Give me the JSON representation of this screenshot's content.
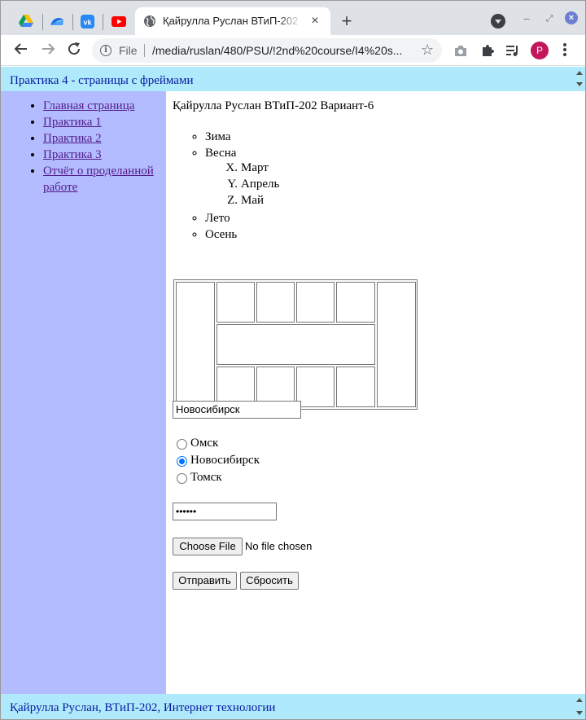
{
  "browser": {
    "tab_title": "Қайрулла Руслан ВТиП-202",
    "tab_close_glyph": "×",
    "new_tab_glyph": "+",
    "url_scheme": "File",
    "url": "/media/ruslan/480/PSU/!2nd%20course/I4%20s...",
    "avatar_letter": "P",
    "pinned_tabs": [
      "google-drive-icon",
      "cloud-app-icon",
      "vk-icon",
      "youtube-icon"
    ],
    "window_controls": {
      "minimize": "–",
      "restore": "⤢",
      "close": "×"
    }
  },
  "top_frame": {
    "title": "Практика 4 - страницы с фреймами"
  },
  "left_nav": {
    "items": [
      "Главная страница",
      "Практика 1",
      "Практика 2",
      "Практика 3",
      "Отчёт о проделанной работе"
    ]
  },
  "main": {
    "heading": "Қайрулла Руслан ВТиП-202 Вариант-6",
    "seasons": [
      "Зима",
      "Весна",
      "Лето",
      "Осень"
    ],
    "months": [
      {
        "marker": "X.",
        "name": "Март"
      },
      {
        "marker": "Y.",
        "name": "Апрель"
      },
      {
        "marker": "Z.",
        "name": "Май"
      }
    ],
    "city_input_value": "Новосибирск",
    "radio_options": [
      {
        "label": "Омск",
        "checked": false
      },
      {
        "label": "Новосибирск",
        "checked": true
      },
      {
        "label": "Томск",
        "checked": false
      }
    ],
    "password_mask": "••••••",
    "file_button": "Choose File",
    "file_status": "No file chosen",
    "submit_button": "Отправить",
    "reset_button": "Сбросить"
  },
  "bottom_frame": {
    "title": "Қайрулла Руслан, ВТиП-202, Интернет технологии"
  },
  "colors": {
    "frame_top_bg": "#aeeafb",
    "frame_left_bg": "#b2bcfe",
    "link": "#551a8b",
    "frame_title_text": "#0a1aa0",
    "radio_accent": "#0075ff"
  }
}
